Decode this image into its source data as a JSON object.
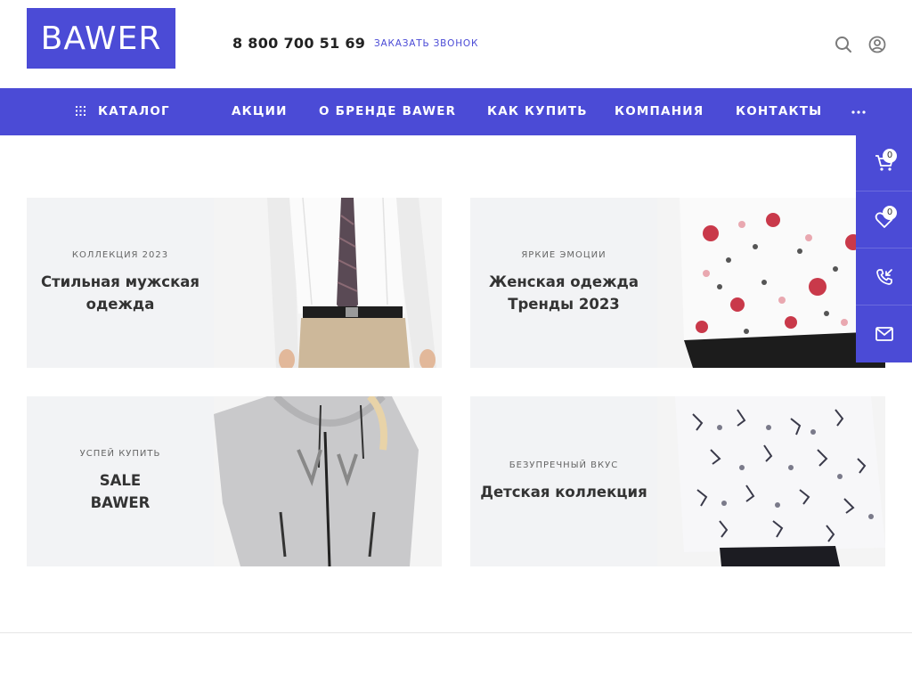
{
  "header": {
    "logo": "BAWER",
    "phone": "8 800 700 51 69",
    "callback_label": "ЗАКАЗАТЬ ЗВОНОК",
    "icons": [
      "search-icon",
      "user-icon"
    ]
  },
  "nav": {
    "items": [
      {
        "label": "КАТАЛОГ"
      },
      {
        "label": "АКЦИИ"
      },
      {
        "label": "О БРЕНДЕ BAWER"
      },
      {
        "label": "КАК КУПИТЬ"
      },
      {
        "label": "КОМПАНИЯ"
      },
      {
        "label": "КОНТАКТЫ"
      }
    ],
    "more_icon": "more-dots-icon"
  },
  "cards": [
    {
      "sub": "КОЛЛЕКЦИЯ 2023",
      "title_line1": "Стильная мужская",
      "title_line2": "одежда"
    },
    {
      "sub": "ЯРКИЕ ЭМОЦИИ",
      "title_line1": "Женская одежда",
      "title_line2": "Тренды 2023"
    },
    {
      "sub": "УСПЕЙ КУПИТЬ",
      "title_line1": "SALE",
      "title_line2": "BAWER"
    },
    {
      "sub": "БЕЗУПРЕЧНЫЙ ВКУС",
      "title_line1": "Детская коллекция",
      "title_line2": ""
    }
  ],
  "floating_panel": {
    "cart_count": "0",
    "favorites_count": "0",
    "icons": [
      "cart-icon",
      "heart-icon",
      "phone-callback-icon",
      "mail-icon"
    ]
  },
  "colors": {
    "accent": "#4b4bd6",
    "card_bg": "#f2f3f5"
  }
}
